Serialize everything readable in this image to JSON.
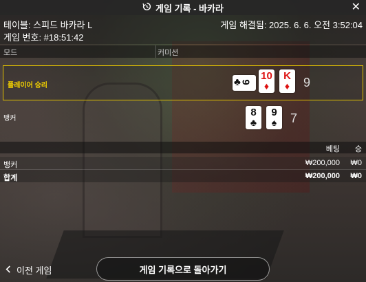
{
  "header": {
    "title": "게임 기록 - 바카라",
    "history_icon": "history-icon",
    "close_icon": "close-icon"
  },
  "info": {
    "table": "테이블: 스피드 바카라 L",
    "round": "게임 번호: #18:51:42",
    "settled": "게임 해결됨: 2025. 6. 6. 오전 3:52:04"
  },
  "columns": {
    "mode": "모드",
    "commission": "커미션"
  },
  "player": {
    "label": "플레이어 승리",
    "total": "9",
    "cards": [
      {
        "rank": "9",
        "suit": "♣",
        "color": "black",
        "orientation": "sideways"
      },
      {
        "rank": "10",
        "suit": "♦",
        "color": "red"
      },
      {
        "rank": "K",
        "suit": "♦",
        "color": "red"
      }
    ]
  },
  "banker": {
    "label": "뱅커",
    "total": "7",
    "cards": [
      {
        "rank": "8",
        "suit": "♣",
        "color": "black"
      },
      {
        "rank": "9",
        "suit": "♠",
        "color": "black"
      }
    ]
  },
  "bets": {
    "head_bet": "베팅",
    "head_win": "승",
    "rows": [
      {
        "name": "뱅커",
        "amount": "₩200,000",
        "win": "₩0"
      }
    ],
    "total": {
      "name": "합계",
      "amount": "₩200,000",
      "win": "₩0"
    }
  },
  "footer": {
    "prev_label": "이전 게임",
    "back_label": "게임 기록으로 돌아가기"
  },
  "colors": {
    "win_highlight": "#e3c200",
    "red_suit": "#dd1111"
  }
}
